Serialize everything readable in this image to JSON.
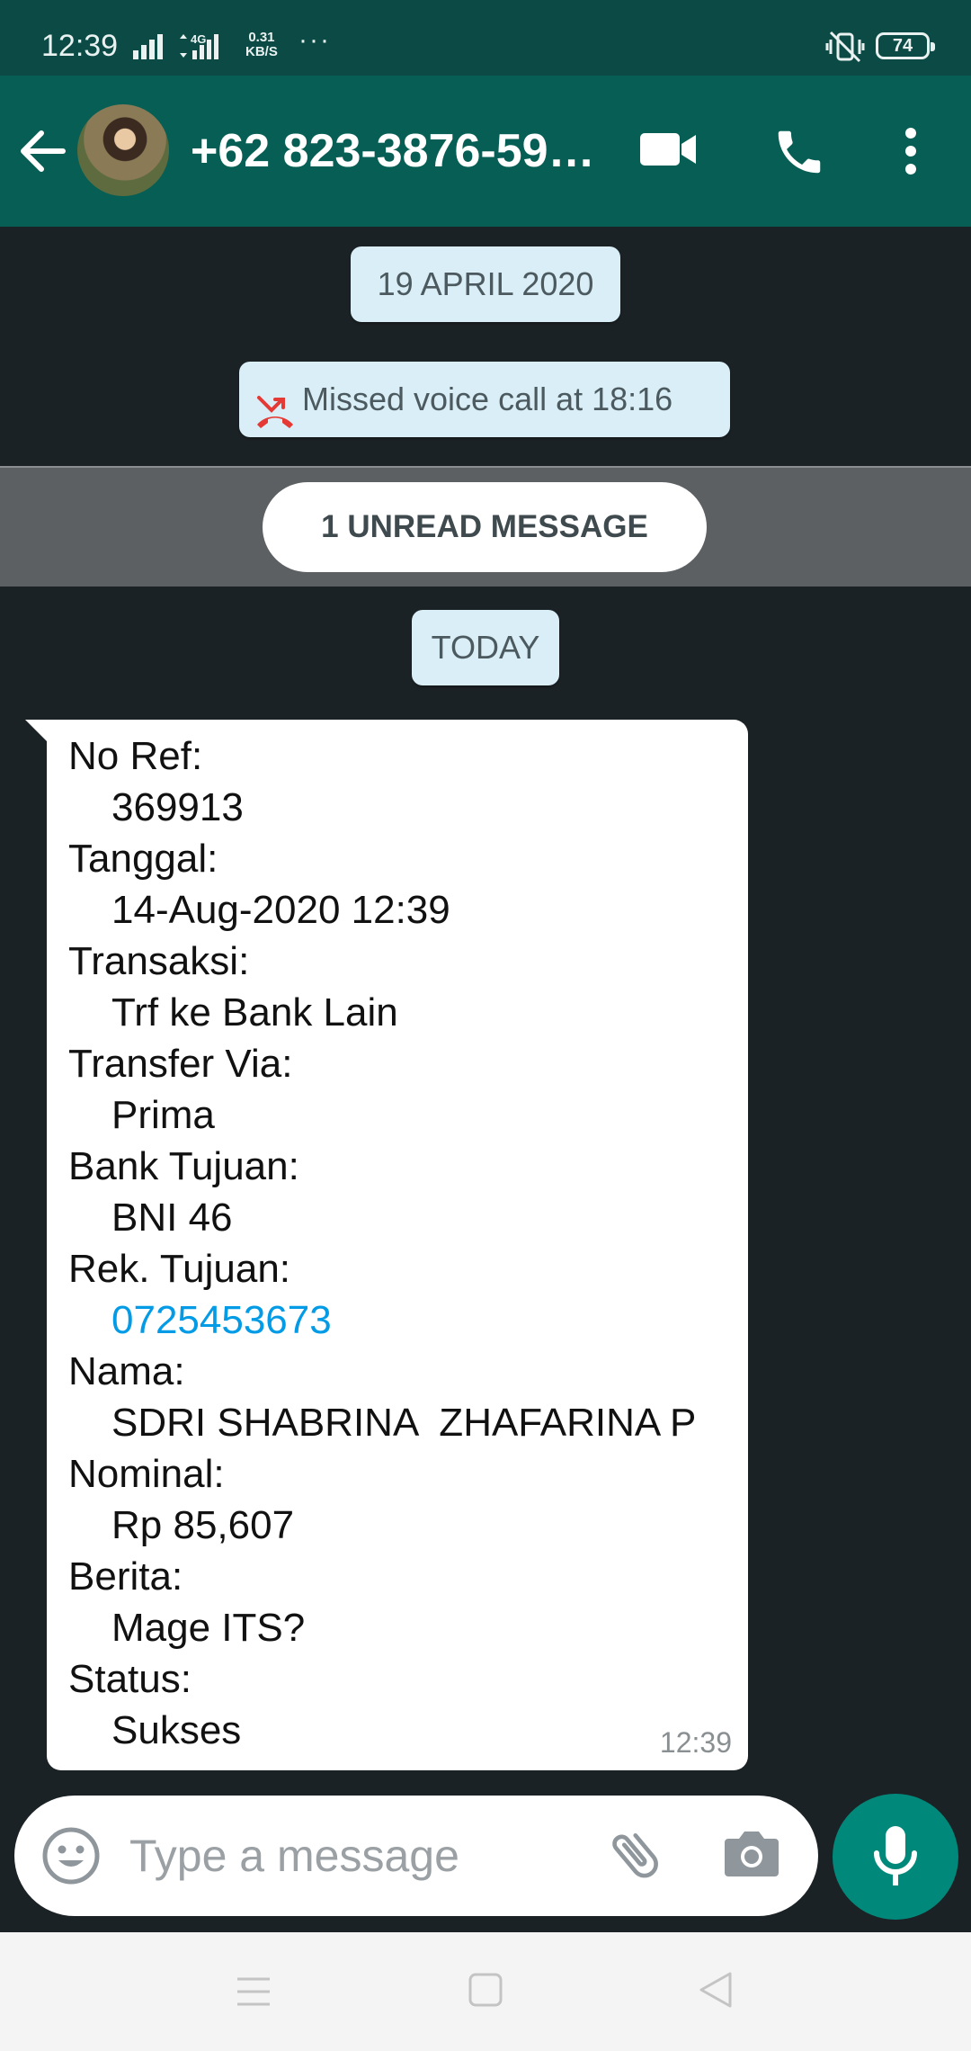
{
  "status_bar": {
    "time": "12:39",
    "net_speed_value": "0.31",
    "net_speed_unit": "KB/S",
    "network_type": "4G",
    "more": "···",
    "battery": "74"
  },
  "header": {
    "contact_name": "+62 823-3876-59…"
  },
  "chat": {
    "date_old": "19 APRIL 2020",
    "missed_call": "Missed voice call at 18:16",
    "unread": "1 UNREAD MESSAGE",
    "date_today": "TODAY",
    "message": {
      "fields": [
        {
          "label": "No Ref:",
          "value": "369913"
        },
        {
          "label": "Tanggal:",
          "value": "14-Aug-2020 12:39"
        },
        {
          "label": "Transaksi:",
          "value": "Trf ke Bank Lain"
        },
        {
          "label": "Transfer Via:",
          "value": "Prima"
        },
        {
          "label": "Bank Tujuan:",
          "value": "BNI 46"
        },
        {
          "label": "Rek. Tujuan:",
          "value": "0725453673"
        },
        {
          "label": "Nama:",
          "value": "SDRI SHABRINA  ZHAFARINA P"
        },
        {
          "label": "Nominal:",
          "value": "Rp 85,607"
        },
        {
          "label": "Berita:",
          "value": "Mage ITS?"
        },
        {
          "label": "Status:",
          "value": "Sukses"
        }
      ],
      "time": "12:39"
    }
  },
  "composer": {
    "placeholder": "Type a message"
  },
  "colors": {
    "header": "#075e54",
    "statusbar": "#0b4a45",
    "chat_bg": "#1b2225",
    "fab": "#00897b",
    "link": "#039be5",
    "missed_call_icon": "#e53935"
  },
  "icons": [
    "back-arrow-icon",
    "video-call-icon",
    "voice-call-icon",
    "more-vert-icon",
    "missed-call-icon",
    "emoji-icon",
    "attach-icon",
    "camera-icon",
    "mic-icon"
  ]
}
